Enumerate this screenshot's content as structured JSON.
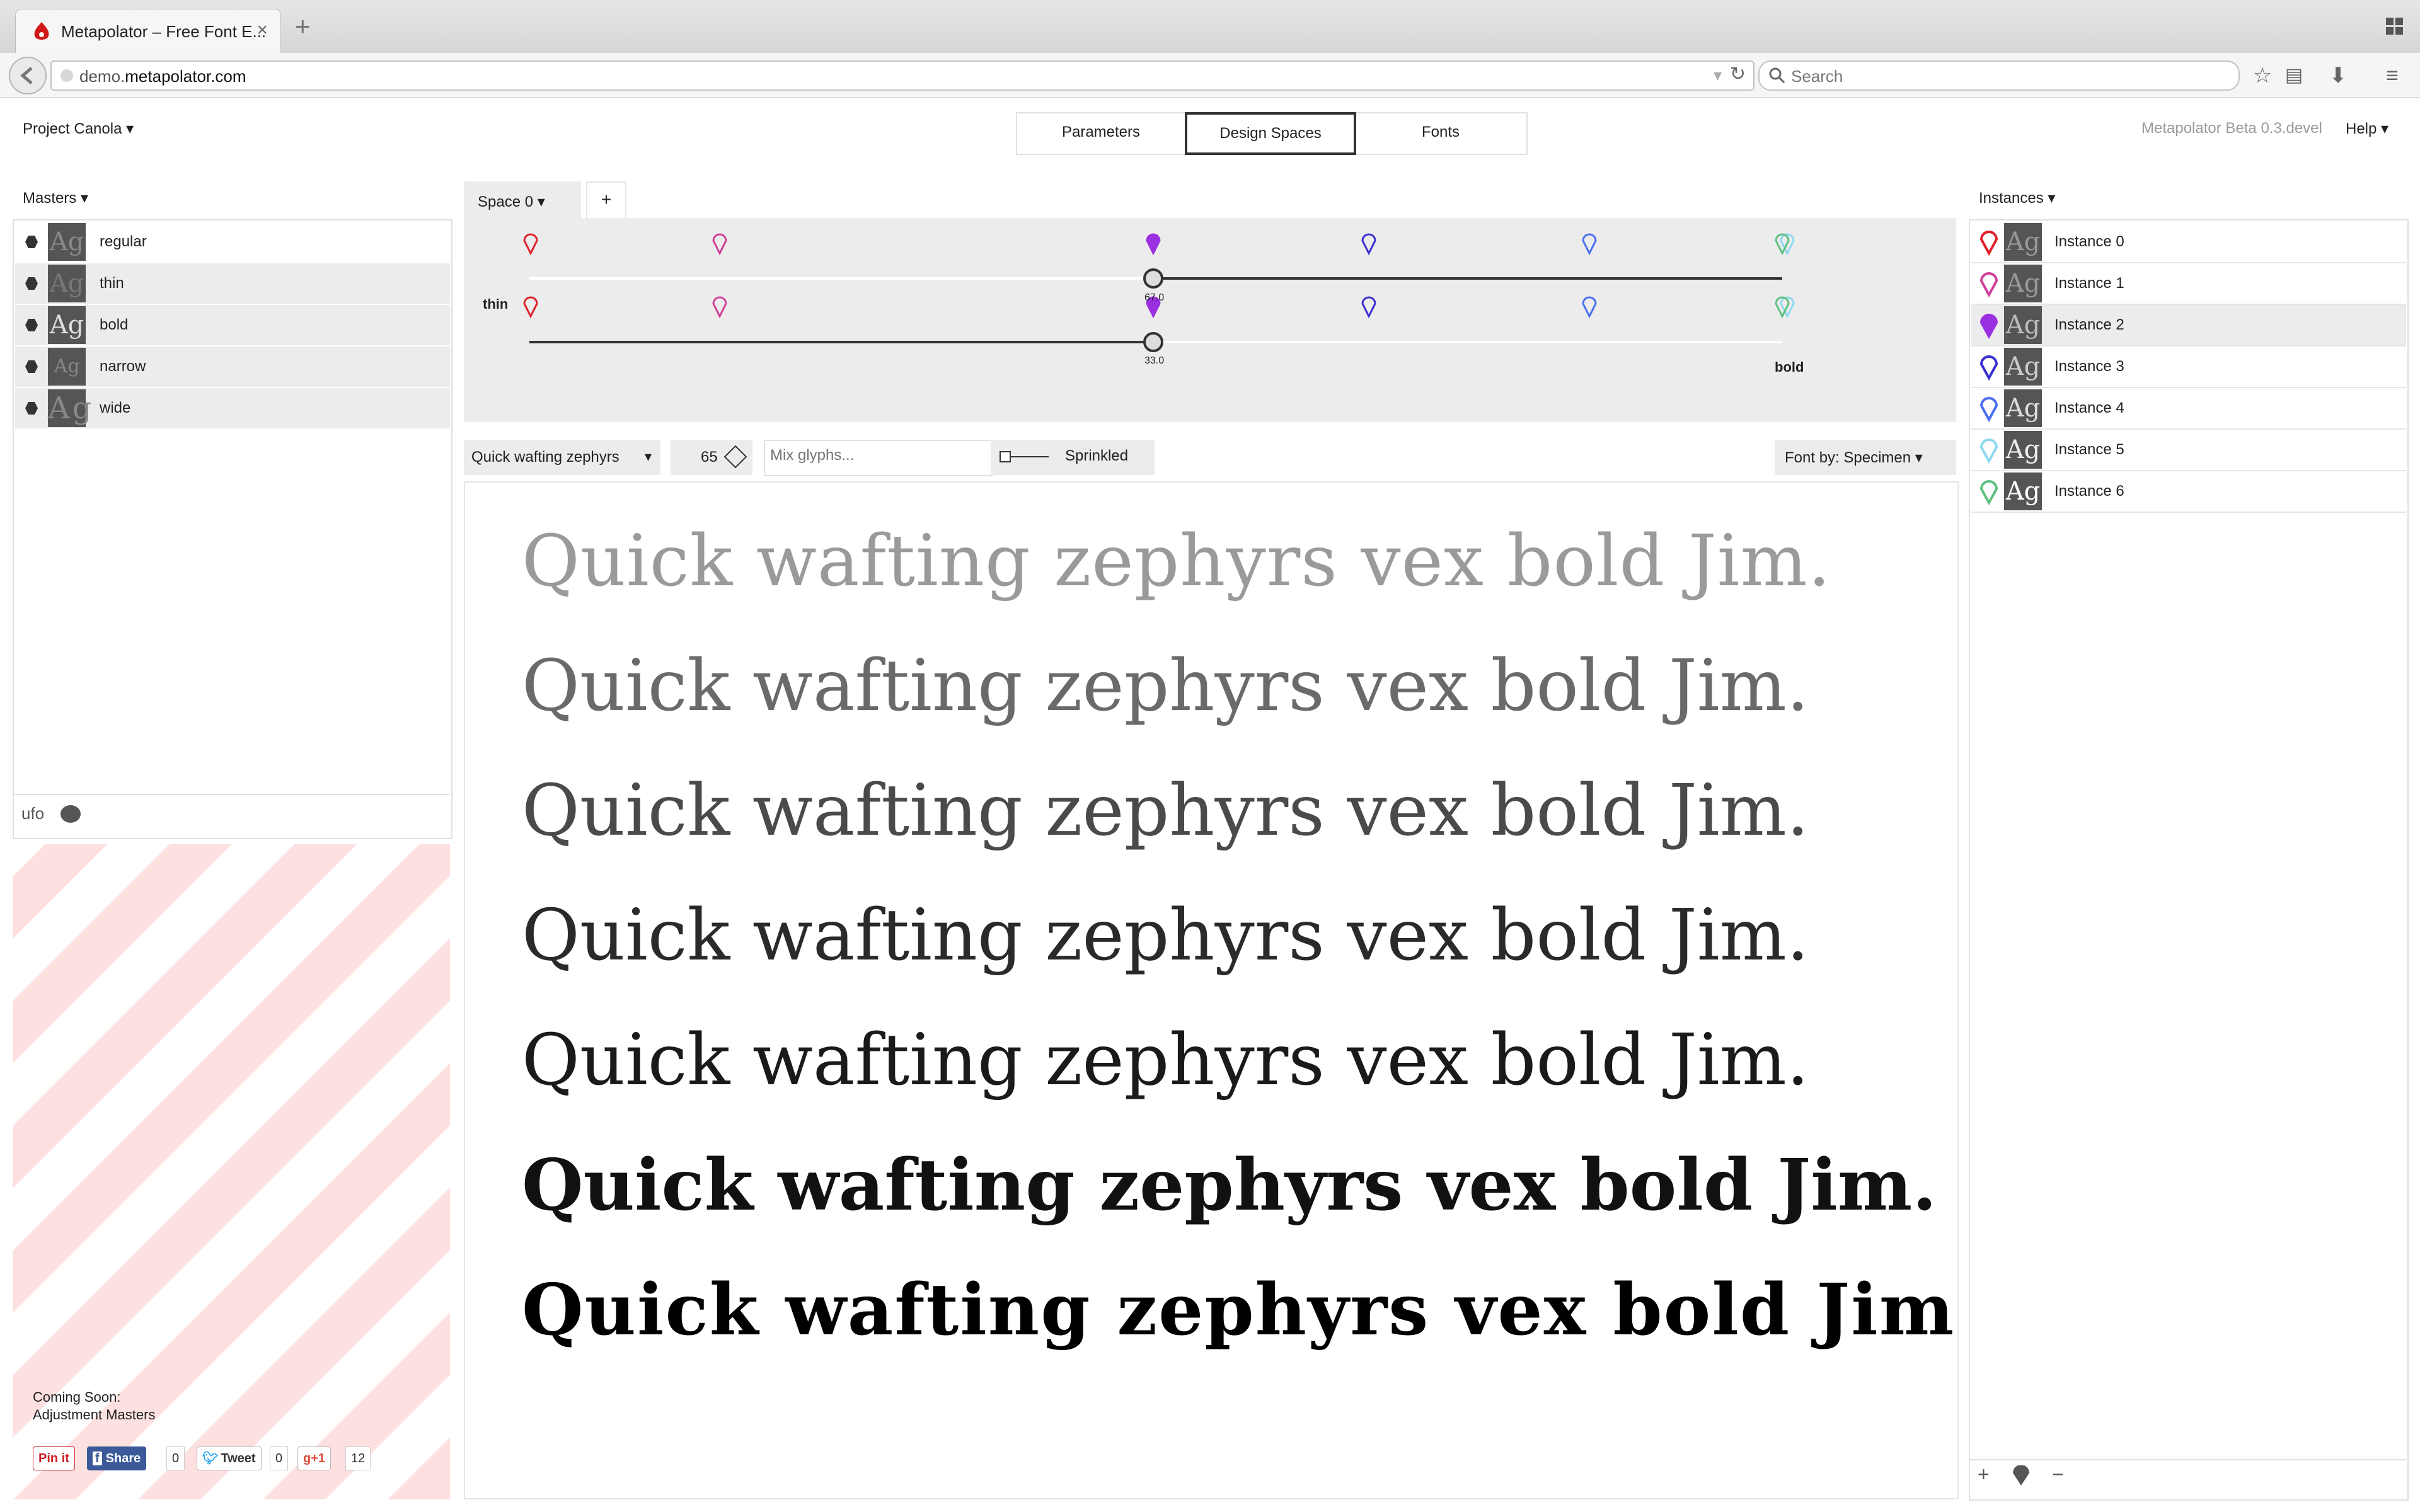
{
  "browser": {
    "tab_title": "Metapolator – Free Font E...",
    "new_tab": "+",
    "url_prefix": "demo.",
    "url_domain": "metapolator.com",
    "search_placeholder": "Search"
  },
  "header": {
    "project": "Project Canola ▾",
    "tabs": [
      "Parameters",
      "Design Spaces",
      "Fonts"
    ],
    "active_tab": "Design Spaces",
    "version": "Metapolator Beta 0.3.devel",
    "help": "Help ▾"
  },
  "masters": {
    "title": "Masters ▾",
    "items": [
      {
        "label": "regular",
        "thumb": "Ag"
      },
      {
        "label": "thin",
        "thumb": "Ag"
      },
      {
        "label": "bold",
        "thumb": "Ag"
      },
      {
        "label": "narrow",
        "thumb": "Ag"
      },
      {
        "label": "wide",
        "thumb": "Ag"
      }
    ],
    "footer_label": "ufo"
  },
  "coming_soon": {
    "line1": "Coming Soon:",
    "line2": "Adjustment Masters"
  },
  "social": {
    "pin": "Pin it",
    "share": "Share",
    "share_count": "0",
    "tweet": "Tweet",
    "tweet_count": "0",
    "gplus": "+1",
    "gplus_count": "12"
  },
  "design_space": {
    "space_tab": "Space 0  ▾",
    "add": "+",
    "left_label": "thin",
    "right_label": "bold",
    "slider1_value": "67.0",
    "slider2_value": "33.0",
    "slider1_fraction": 0.33,
    "slider2_fraction": 0.33,
    "pin_colors": [
      "#e0202a",
      "#d0409a",
      "#9b30e0",
      "#3a2fd0",
      "#4a6ff0",
      "#8fd8f0",
      "#5fc080"
    ]
  },
  "toolbar": {
    "specimen": "Quick wafting zephyrs",
    "specimen_arrow": "▾",
    "font_size": "65",
    "mix_placeholder": "Mix glyphs...",
    "sprinkled": "Sprinkled",
    "font_by": "Font by:  Specimen  ▾"
  },
  "specimen_lines": [
    "Quick wafting zephyrs vex bold Jim.",
    "Quick wafting zephyrs vex bold Jim.",
    "Quick wafting zephyrs vex bold Jim.",
    "Quick wafting zephyrs vex bold Jim.",
    "Quick wafting zephyrs vex bold Jim.",
    "Quick wafting zephyrs vex bold Jim.",
    "Quick wafting zephyrs vex bold Jim."
  ],
  "instances": {
    "title": "Instances ▾",
    "items": [
      {
        "label": "Instance 0",
        "color": "#e0202a",
        "thumb": "Ag"
      },
      {
        "label": "Instance 1",
        "color": "#d0409a",
        "thumb": "Ag"
      },
      {
        "label": "Instance 2",
        "color": "#9b30e0",
        "thumb": "Ag"
      },
      {
        "label": "Instance 3",
        "color": "#3a2fd0",
        "thumb": "Ag"
      },
      {
        "label": "Instance 4",
        "color": "#4a6ff0",
        "thumb": "Ag"
      },
      {
        "label": "Instance 5",
        "color": "#8fd8f0",
        "thumb": "Ag"
      },
      {
        "label": "Instance 6",
        "color": "#5fc080",
        "thumb": "Ag"
      }
    ],
    "selected_index": 2,
    "footer_add": "+",
    "footer_remove": "−"
  }
}
